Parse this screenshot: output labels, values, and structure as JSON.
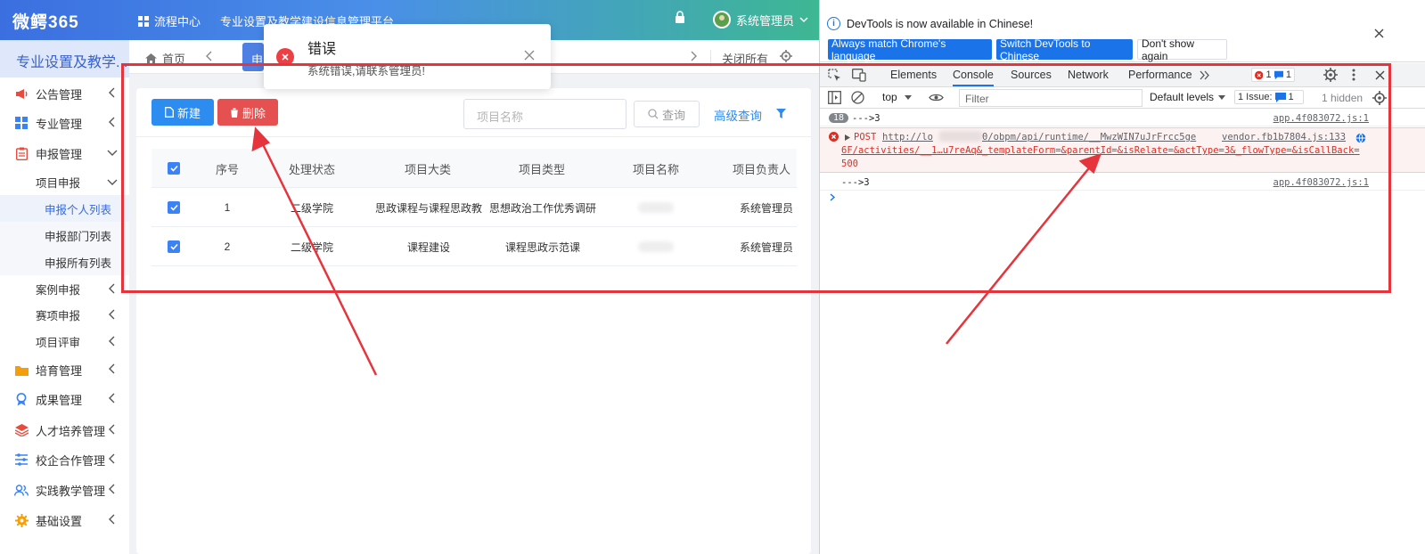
{
  "app": {
    "logo": "微鳄365",
    "topnav_flow": "流程中心",
    "topnav_title": "专业设置及教学建设信息管理平台",
    "user": "系统管理员"
  },
  "sidebar": {
    "header": "专业设置及教学...",
    "items": [
      {
        "label": "公告管理",
        "icon": "megaphone-icon"
      },
      {
        "label": "专业管理",
        "icon": "grid-icon"
      },
      {
        "label": "申报管理",
        "icon": "clipboard-icon"
      },
      {
        "label": "项目申报"
      },
      {
        "label": "申报个人列表"
      },
      {
        "label": "申报部门列表"
      },
      {
        "label": "申报所有列表"
      },
      {
        "label": "案例申报"
      },
      {
        "label": "赛项申报"
      },
      {
        "label": "项目评审"
      },
      {
        "label": "培育管理",
        "icon": "folder-icon"
      },
      {
        "label": "成果管理",
        "icon": "award-icon"
      },
      {
        "label": "人才培养管理",
        "icon": "layers-icon"
      },
      {
        "label": "校企合作管理",
        "icon": "sliders-icon"
      },
      {
        "label": "实践教学管理",
        "icon": "users-icon"
      },
      {
        "label": "基础设置",
        "icon": "gear-icon"
      }
    ]
  },
  "tabs": {
    "home": "首页",
    "active": "申",
    "close_all": "关闭所有"
  },
  "toolbar": {
    "new_label": "新建",
    "delete_label": "删除",
    "search_placeholder": "项目名称",
    "query_label": "查询",
    "advanced_label": "高级查询"
  },
  "table": {
    "headers": [
      "序号",
      "处理状态",
      "项目大类",
      "项目类型",
      "项目名称",
      "项目负责人"
    ],
    "rows": [
      [
        "1",
        "二级学院",
        "思政课程与课程思政教",
        "思想政治工作优秀调研",
        "",
        "系统管理员"
      ],
      [
        "2",
        "二级学院",
        "课程建设",
        "课程思政示范课",
        "",
        "系统管理员"
      ]
    ]
  },
  "toast": {
    "title": "错误",
    "message": "系统错误,请联系管理员!"
  },
  "devtools": {
    "info": "DevTools is now available in Chinese!",
    "btn_match": "Always match Chrome's language",
    "btn_switch": "Switch DevTools to Chinese",
    "btn_dont": "Don't show again",
    "tabs": [
      "Elements",
      "Console",
      "Sources",
      "Network",
      "Performance"
    ],
    "err_count": "1",
    "msg_count": "1",
    "context": "top",
    "filter_placeholder": "Filter",
    "levels": "Default levels",
    "issues": "1 Issue:",
    "issues_count": "1",
    "hidden": "1 hidden",
    "console": {
      "row1_count": "18",
      "row1_text": "--->3",
      "row1_src": "app.4f083072.js:1",
      "err_method": "POST",
      "err_url_1": "http://lo",
      "err_url_2": "0/obpm/api/runtime/__MwzWIN7uJrFrcc5ge",
      "err_src": "vendor.fb1b7804.js:133",
      "err_line2": "6F/activities/__1…u7reAq&_templateForm=&parentId=&isRelate=&actType=3&_flowType=&isCallBack=",
      "err_status": "500",
      "row3_text": "--->3",
      "row3_src": "app.4f083072.js:1"
    }
  },
  "colors": {
    "primary": "#2d8cf0",
    "danger": "#e55050",
    "annotation": "#e6343d"
  }
}
